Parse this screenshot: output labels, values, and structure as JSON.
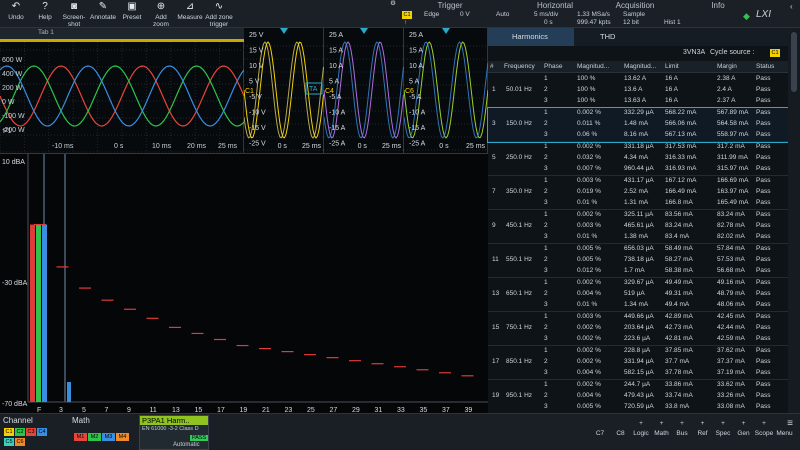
{
  "toolbar": {
    "buttons": [
      {
        "label": "Undo",
        "icon": "undo-icon",
        "glyph": "↶"
      },
      {
        "label": "Help",
        "icon": "help-icon",
        "glyph": "?"
      },
      {
        "label": "Screen-\nshot",
        "icon": "camera-icon",
        "glyph": "◙"
      },
      {
        "label": "Annotate",
        "icon": "pencil-icon",
        "glyph": "✎"
      },
      {
        "label": "Preset",
        "icon": "preset-icon",
        "glyph": "▣"
      },
      {
        "label": "Add\nzoom",
        "icon": "zoom-icon",
        "glyph": "⊕"
      },
      {
        "label": "Measure",
        "icon": "measure-icon",
        "glyph": "⊿"
      },
      {
        "label": "Add zone\ntrigger",
        "icon": "zone-trigger-icon",
        "glyph": "∿"
      }
    ],
    "trigger": {
      "label": "Trigger",
      "channel": "C1",
      "type": "Edge",
      "level": "0 V",
      "mode": "Auto",
      "slope": "↑"
    },
    "horizontal": {
      "label": "Horizontal",
      "scale": "5 ms/div",
      "position": "0 s"
    },
    "acquisition": {
      "label": "Acquisition",
      "rate": "1.33 MSa/s",
      "points": "999.47 kpts",
      "mode": "Sample",
      "bits": "12 bit",
      "hist": "Hist 1"
    },
    "info": {
      "label": "Info"
    }
  },
  "overview": {
    "tab": "Tab 1",
    "ticks_y": [
      "600 W",
      "400 W",
      "200 W",
      "0 W",
      "-100 W",
      "-200 W"
    ],
    "ticks_x": [
      "-10 ms",
      "0 s",
      "10 ms",
      "20 ms",
      "25 ms"
    ],
    "marker": "P1"
  },
  "panels": [
    {
      "ch": "C1",
      "ticks_y": [
        "25 V",
        "15 V",
        "10 V",
        "5 V",
        "-5 V",
        "-10 V",
        "-15 V",
        "-25 V"
      ],
      "ticks_x": [
        "0 s",
        "25 ms"
      ],
      "tag": "TA"
    },
    {
      "ch": "C4",
      "ticks_y": [
        "25 A",
        "15 A",
        "10 A",
        "5 A",
        "-5 A",
        "-10 A",
        "-15 A",
        "-25 A"
      ],
      "ticks_x": [
        "0 s",
        "25 ms"
      ]
    },
    {
      "ch": "C6",
      "ticks_y": [
        "25 A",
        "15 A",
        "10 A",
        "5 A",
        "-5 A",
        "-10 A",
        "-15 A",
        "-25 A"
      ],
      "ticks_x": [
        "0 s",
        "25 ms"
      ]
    }
  ],
  "spectrum": {
    "ylabels": [
      "10 dBA",
      "-30 dBA",
      "-70 dBA"
    ],
    "xlabels": [
      "F",
      "3",
      "5",
      "7",
      "9",
      "11",
      "13",
      "15",
      "17",
      "19",
      "21",
      "23",
      "25",
      "27",
      "29",
      "31",
      "33",
      "35",
      "37",
      "39"
    ],
    "bars": [
      {
        "h": -12,
        "color": "#e03a3a"
      },
      {
        "h": -12,
        "color": "#2ec34a"
      },
      {
        "h": -12,
        "color": "#3a8ee0"
      }
    ],
    "levels": [
      -12,
      -26,
      -33,
      -37,
      -40,
      -43,
      -46,
      -48,
      -50,
      -52,
      -53,
      -54,
      -55,
      -56,
      -57,
      -58,
      -59,
      -60,
      -61,
      -62
    ]
  },
  "harmonics": {
    "tab_active": "Harmonics",
    "tab2": "THD",
    "standard": "3VN3A",
    "cycle_label": "Cycle source :",
    "cycle_ch": "C1",
    "columns": [
      "#",
      "Frequency",
      "Phase",
      "Magnitud...",
      "Magnitud...",
      "Limit",
      "Margin",
      "Status"
    ],
    "groups": [
      {
        "n": "1",
        "freq": "50.01 Hz",
        "rows": [
          [
            "1",
            "100 %",
            "13.62 A",
            "16 A",
            "2.38 A",
            "Pass"
          ],
          [
            "2",
            "100 %",
            "13.6 A",
            "16 A",
            "2.4 A",
            "Pass"
          ],
          [
            "3",
            "100 %",
            "13.63 A",
            "16 A",
            "2.37 A",
            "Pass"
          ]
        ]
      },
      {
        "n": "3",
        "freq": "150.0 Hz",
        "rows": [
          [
            "1",
            "0.002 %",
            "332.29 µA",
            "568.22 mA",
            "567.89 mA",
            "Pass"
          ],
          [
            "2",
            "0.011 %",
            "1.48 mA",
            "566.06 mA",
            "564.58 mA",
            "Pass"
          ],
          [
            "3",
            "0.06 %",
            "8.16 mA",
            "567.13 mA",
            "558.97 mA",
            "Pass"
          ]
        ]
      },
      {
        "n": "5",
        "freq": "250.0 Hz",
        "rows": [
          [
            "1",
            "0.002 %",
            "331.18 µA",
            "317.53 mA",
            "317.2 mA",
            "Pass"
          ],
          [
            "2",
            "0.032 %",
            "4.34 mA",
            "316.33 mA",
            "311.99 mA",
            "Pass"
          ],
          [
            "3",
            "0.007 %",
            "960.44 µA",
            "316.93 mA",
            "315.97 mA",
            "Pass"
          ]
        ]
      },
      {
        "n": "7",
        "freq": "350.0 Hz",
        "rows": [
          [
            "1",
            "0.003 %",
            "431.17 µA",
            "167.12 mA",
            "166.69 mA",
            "Pass"
          ],
          [
            "2",
            "0.019 %",
            "2.52 mA",
            "166.49 mA",
            "163.97 mA",
            "Pass"
          ],
          [
            "3",
            "0.01 %",
            "1.31 mA",
            "166.8 mA",
            "165.49 mA",
            "Pass"
          ]
        ]
      },
      {
        "n": "9",
        "freq": "450.1 Hz",
        "rows": [
          [
            "1",
            "0.002 %",
            "325.11 µA",
            "83.56 mA",
            "83.24 mA",
            "Pass"
          ],
          [
            "2",
            "0.003 %",
            "465.61 µA",
            "83.24 mA",
            "82.78 mA",
            "Pass"
          ],
          [
            "3",
            "0.01 %",
            "1.38 mA",
            "83.4 mA",
            "82.02 mA",
            "Pass"
          ]
        ]
      },
      {
        "n": "11",
        "freq": "550.1 Hz",
        "rows": [
          [
            "1",
            "0.005 %",
            "656.03 µA",
            "58.49 mA",
            "57.84 mA",
            "Pass"
          ],
          [
            "2",
            "0.005 %",
            "738.18 µA",
            "58.27 mA",
            "57.53 mA",
            "Pass"
          ],
          [
            "3",
            "0.012 %",
            "1.7 mA",
            "58.38 mA",
            "56.68 mA",
            "Pass"
          ]
        ]
      },
      {
        "n": "13",
        "freq": "650.1 Hz",
        "rows": [
          [
            "1",
            "0.002 %",
            "329.67 µA",
            "49.49 mA",
            "49.16 mA",
            "Pass"
          ],
          [
            "2",
            "0.004 %",
            "519 µA",
            "49.31 mA",
            "48.79 mA",
            "Pass"
          ],
          [
            "3",
            "0.01 %",
            "1.34 mA",
            "49.4 mA",
            "48.06 mA",
            "Pass"
          ]
        ]
      },
      {
        "n": "15",
        "freq": "750.1 Hz",
        "rows": [
          [
            "1",
            "0.003 %",
            "449.66 µA",
            "42.89 mA",
            "42.45 mA",
            "Pass"
          ],
          [
            "2",
            "0.002 %",
            "203.64 µA",
            "42.73 mA",
            "42.44 mA",
            "Pass"
          ],
          [
            "3",
            "0.002 %",
            "223.6 µA",
            "42.81 mA",
            "42.59 mA",
            "Pass"
          ]
        ]
      },
      {
        "n": "17",
        "freq": "850.1 Hz",
        "rows": [
          [
            "1",
            "0.002 %",
            "228.8 µA",
            "37.85 mA",
            "37.62 mA",
            "Pass"
          ],
          [
            "2",
            "0.002 %",
            "331.94 µA",
            "37.7 mA",
            "37.37 mA",
            "Pass"
          ],
          [
            "3",
            "0.004 %",
            "582.15 µA",
            "37.78 mA",
            "37.19 mA",
            "Pass"
          ]
        ]
      },
      {
        "n": "19",
        "freq": "950.1 Hz",
        "rows": [
          [
            "1",
            "0.002 %",
            "244.7 µA",
            "33.86 mA",
            "33.62 mA",
            "Pass"
          ],
          [
            "2",
            "0.004 %",
            "479.43 µA",
            "33.74 mA",
            "33.26 mA",
            "Pass"
          ],
          [
            "3",
            "0.005 %",
            "720.59 µA",
            "33.8 mA",
            "33.08 mA",
            "Pass"
          ]
        ]
      }
    ]
  },
  "bottom": {
    "channel_label": "Channel",
    "math_label": "Math",
    "channels": [
      "C1",
      "C2",
      "C3",
      "C4",
      "C5",
      "C6"
    ],
    "math": [
      "M1",
      "M2",
      "M3",
      "M4"
    ],
    "app": {
      "name": "P3PA1 Harm..",
      "std": "EN 61000 -3-2 Class D",
      "status": "PASS",
      "mode": "Automatic"
    },
    "buttons": [
      "C7",
      "C8",
      "Logic",
      "Math",
      "Bus",
      "Ref",
      "Spec",
      "Gen",
      "Scope",
      "Menu"
    ]
  },
  "colors": {
    "c1": "#f5d000",
    "c2": "#2ec34a",
    "c3": "#e8443a",
    "c4": "#3a8ee0",
    "c5": "#39d0c0",
    "c6": "#f08a2a",
    "accent": "#2aa8c8",
    "pass": "#34c759"
  }
}
